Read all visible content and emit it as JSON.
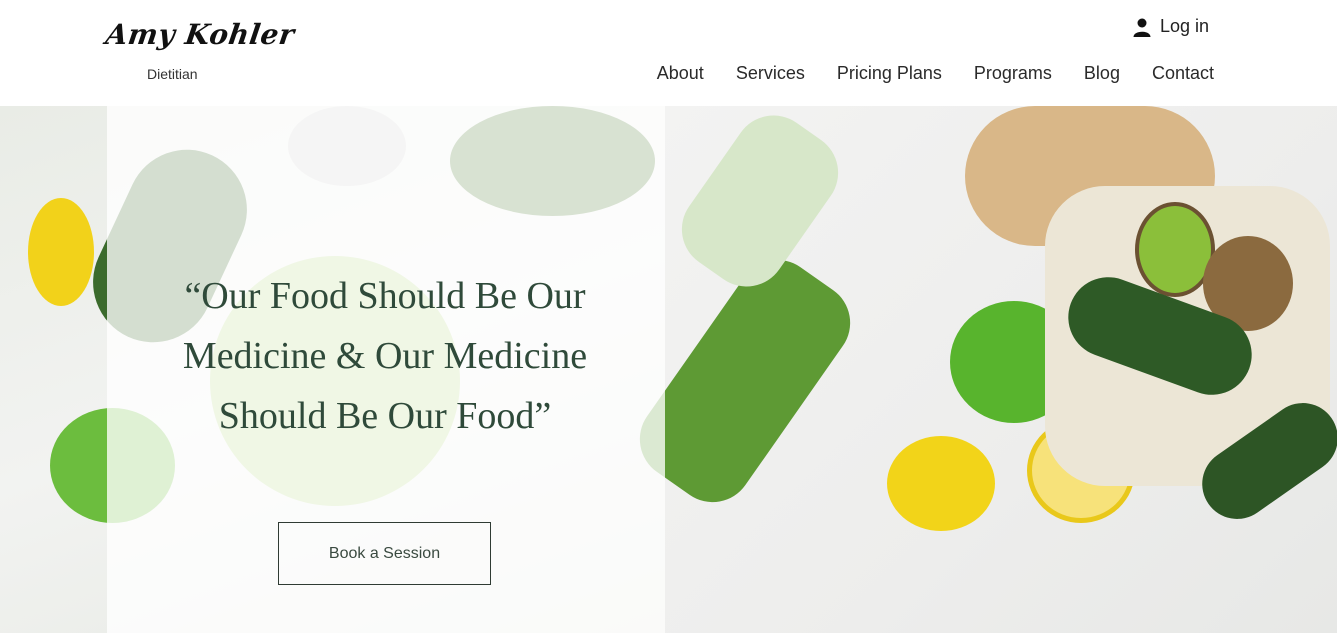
{
  "brand": {
    "name": "Amy Kohler",
    "tagline": "Dietitian"
  },
  "header": {
    "login_label": "Log in",
    "login_icon": "user-icon",
    "nav": [
      "About",
      "Services",
      "Pricing Plans",
      "Programs",
      "Blog",
      "Contact"
    ]
  },
  "hero": {
    "quote": "“Our Food Should Be Our Medicine & Our Medicine Should Be Our Food”",
    "cta_label": "Book a Session"
  },
  "colors": {
    "accent_text": "#2f4a3a",
    "button_border": "#2f3b33"
  }
}
